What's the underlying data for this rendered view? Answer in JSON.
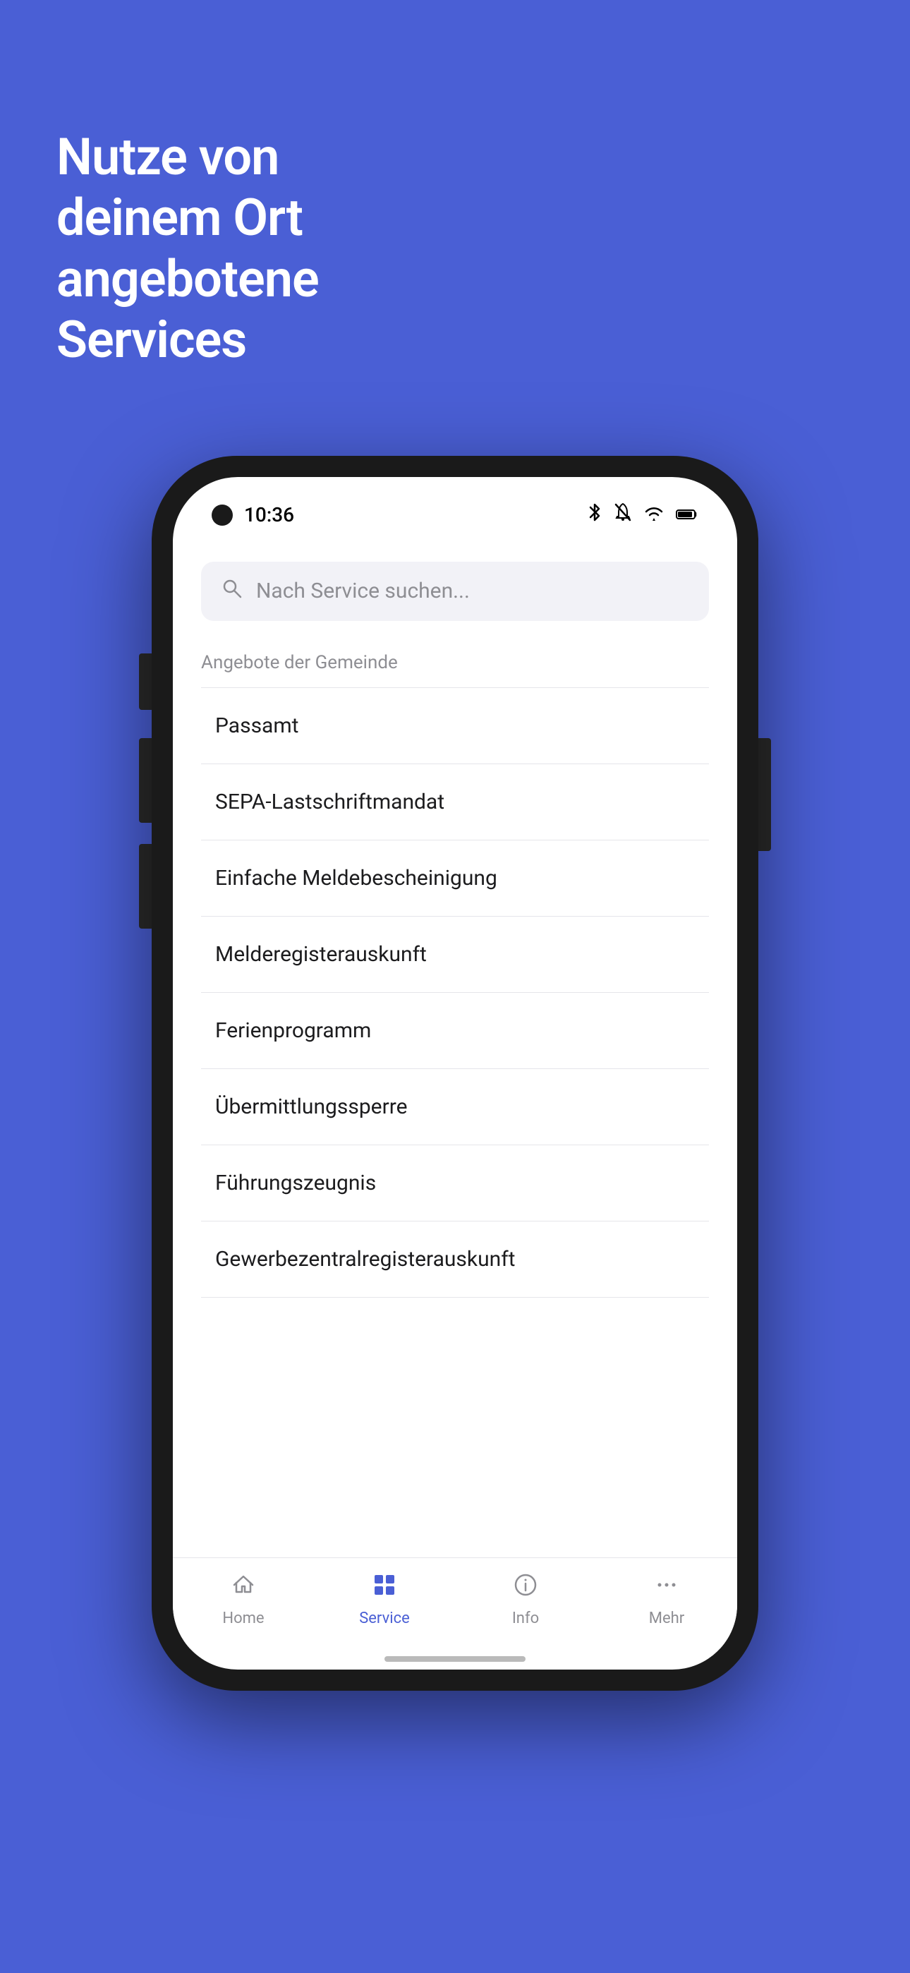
{
  "background_color": "#4A5FD5",
  "hero": {
    "title": "Nutze von deinem Ort angebotene Services"
  },
  "status_bar": {
    "time": "10:36",
    "icons": [
      "bluetooth",
      "muted",
      "wifi",
      "battery"
    ]
  },
  "search": {
    "placeholder": "Nach Service suchen..."
  },
  "section": {
    "label": "Angebote der Gemeinde"
  },
  "services": [
    {
      "name": "Passamt"
    },
    {
      "name": "SEPA-Lastschriftmandat"
    },
    {
      "name": "Einfache Meldebescheinigung"
    },
    {
      "name": "Melderegisterauskunft"
    },
    {
      "name": "Ferienprogramm"
    },
    {
      "name": "Übermittlungssperre"
    },
    {
      "name": "Führungszeugnis"
    },
    {
      "name": "Gewerbezentralregisterauskunft"
    }
  ],
  "tabs": [
    {
      "label": "Home",
      "icon": "home",
      "active": false
    },
    {
      "label": "Service",
      "icon": "grid",
      "active": true
    },
    {
      "label": "Info",
      "icon": "info-circle",
      "active": false
    },
    {
      "label": "Mehr",
      "icon": "more",
      "active": false
    }
  ]
}
